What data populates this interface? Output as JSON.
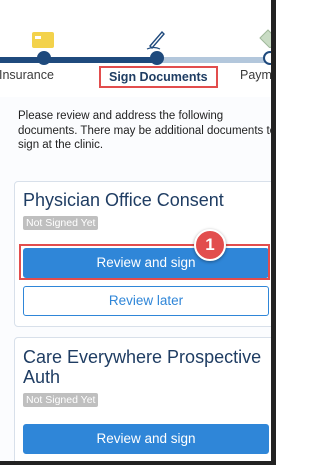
{
  "steps": [
    {
      "label": "Insurance",
      "icon": "insurance-card-icon",
      "state": "done"
    },
    {
      "label": "Sign Documents",
      "icon": "pen-sign-icon",
      "state": "current"
    },
    {
      "label": "Payme",
      "icon": "payment-icon",
      "state": "upcoming"
    }
  ],
  "intro": "Please review and address the following documents. There may be additional documents to sign at the clinic.",
  "documents": [
    {
      "title": "Physician Office Consent",
      "status": "Not Signed Yet",
      "primary_action": "Review and sign",
      "secondary_action": "Review later"
    },
    {
      "title": "Care Everywhere Prospective Auth",
      "status": "Not Signed Yet",
      "primary_action": "Review and sign"
    }
  ],
  "annotation": {
    "step_number": "1"
  },
  "colors": {
    "accent": "#2f86d8",
    "progress": "#1f4a7d",
    "highlight": "#e24d4d",
    "badge": "#bfbfbf"
  }
}
